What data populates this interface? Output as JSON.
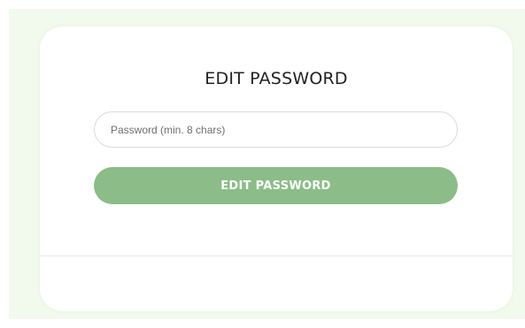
{
  "form": {
    "title": "EDIT PASSWORD",
    "password": {
      "placeholder": "Password (min. 8 chars)",
      "value": ""
    },
    "submit_label": "EDIT PASSWORD"
  },
  "colors": {
    "background": "#f2faee",
    "card": "#ffffff",
    "button": "#8cbc88",
    "button_text": "#ffffff",
    "title_text": "#222222"
  }
}
